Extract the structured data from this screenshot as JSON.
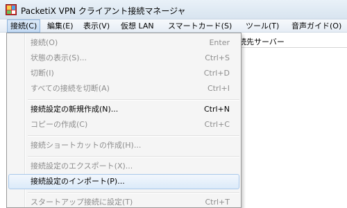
{
  "window": {
    "title": "PacketiX VPN クライアント接続マネージャ",
    "icon": "packetix-app-icon"
  },
  "menubar": {
    "items": [
      {
        "label": "接続(C)",
        "active": true
      },
      {
        "label": "編集(E)",
        "active": false
      },
      {
        "label": "表示(V)",
        "active": false
      },
      {
        "label": "仮想 LAN",
        "active": false
      },
      {
        "label": "スマートカード(S)",
        "active": false
      },
      {
        "label": "ツール(T)",
        "active": false
      },
      {
        "label": "音声ガイド(O)",
        "active": false
      }
    ]
  },
  "list": {
    "visible_column_header": "続先サーバー"
  },
  "connect_menu": {
    "items": [
      {
        "label": "接続(O)",
        "shortcut": "Enter",
        "enabled": false
      },
      {
        "label": "状態の表示(S)...",
        "shortcut": "Ctrl+S",
        "enabled": false
      },
      {
        "label": "切断(I)",
        "shortcut": "Ctrl+D",
        "enabled": false
      },
      {
        "label": "すべての接続を切断(A)",
        "shortcut": "Ctrl+I",
        "enabled": false
      },
      {
        "label": "接続設定の新規作成(N)...",
        "shortcut": "Ctrl+N",
        "enabled": true
      },
      {
        "label": "コピーの作成(C)",
        "shortcut": "Ctrl+C",
        "enabled": false
      },
      {
        "label": "接続ショートカットの作成(H)...",
        "shortcut": "",
        "enabled": false
      },
      {
        "label": "接続設定のエクスポート(X)...",
        "shortcut": "",
        "enabled": false
      },
      {
        "label": "接続設定のインポート(P)...",
        "shortcut": "",
        "enabled": true,
        "highlighted": true
      },
      {
        "label": "スタートアップ接続に設定(T)",
        "shortcut": "Ctrl+T",
        "enabled": false
      }
    ]
  },
  "colors": {
    "highlight_border": "#a8c8eb",
    "disabled_text": "#8d8d8d",
    "menu_background": "#f5f5f5"
  }
}
